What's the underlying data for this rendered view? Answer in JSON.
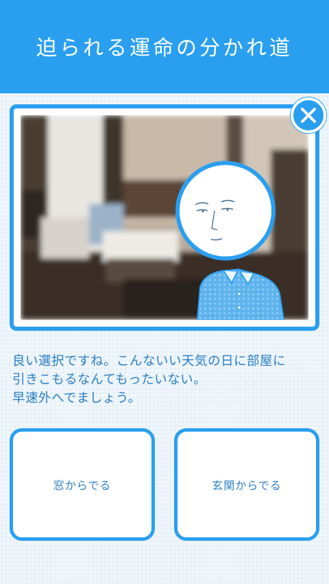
{
  "header": {
    "title": "迫られる運命の分かれ道"
  },
  "scene": {
    "photo": "blurred-living-room-photo",
    "character": "round-head-character-in-polka-dot-shirt",
    "close_icon": "close-icon"
  },
  "message": {
    "lines": [
      "良い選択ですね。こんないい天気の日に部屋に",
      "引きこもるなんてもったいない。",
      "早速外へでましょう。"
    ]
  },
  "choices": [
    {
      "label": "窓からでる"
    },
    {
      "label": "玄関からでる"
    }
  ],
  "colors": {
    "accent": "#2a9ff0",
    "text": "#2a7fc4",
    "background": "#eef5fb"
  }
}
